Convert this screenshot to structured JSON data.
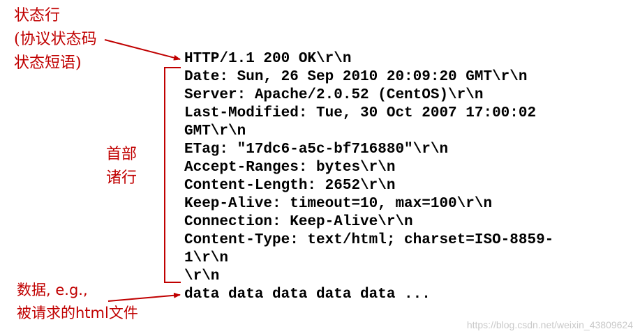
{
  "annotations": {
    "status_line": [
      "状态行",
      "(协议状态码",
      "状态短语)"
    ],
    "header_lines": [
      "首部",
      "诸行"
    ],
    "body": [
      "数据, e.g.,",
      "被请求的html文件"
    ]
  },
  "message": {
    "status_line": "HTTP/1.1 200 OK\\r\\n",
    "headers": [
      "Date: Sun, 26 Sep 2010 20:09:20 GMT\\r\\n",
      "Server: Apache/2.0.52 (CentOS)\\r\\n",
      "Last-Modified: Tue, 30 Oct 2007 17:00:02",
      "GMT\\r\\n",
      "ETag: \"17dc6-a5c-bf716880\"\\r\\n",
      "Accept-Ranges: bytes\\r\\n",
      "Content-Length: 2652\\r\\n",
      "Keep-Alive: timeout=10, max=100\\r\\n",
      "Connection: Keep-Alive\\r\\n",
      "Content-Type: text/html; charset=ISO-8859-",
      "1\\r\\n"
    ],
    "blank_line": "\\r\\n",
    "body": "data data data data data ..."
  },
  "watermark": "https://blog.csdn.net/weixin_43809624",
  "colors": {
    "annotation": "#c00000",
    "text": "#000000",
    "watermark": "#c9c9c9"
  }
}
